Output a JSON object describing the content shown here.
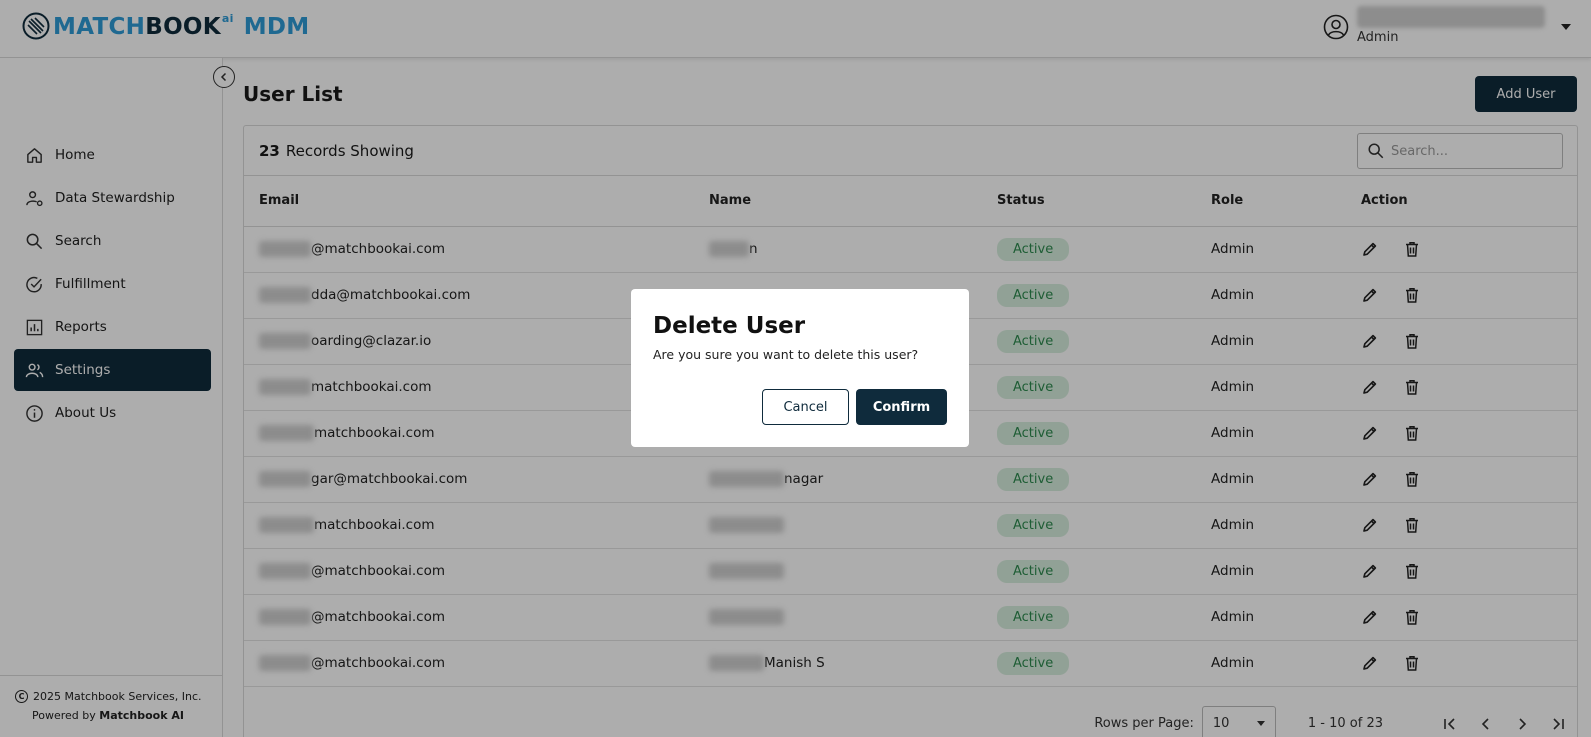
{
  "header": {
    "brand_blue": "MATCH",
    "brand_dark": "BOOK",
    "brand_sup": "ai",
    "brand_mdm": "MDM",
    "user_role": "Admin"
  },
  "sidebar": {
    "items": [
      {
        "label": "Home",
        "icon": "home-icon"
      },
      {
        "label": "Data Stewardship",
        "icon": "user-gear-icon"
      },
      {
        "label": "Search",
        "icon": "search-icon"
      },
      {
        "label": "Fulfillment",
        "icon": "check-circle-icon"
      },
      {
        "label": "Reports",
        "icon": "bar-chart-icon"
      },
      {
        "label": "Settings",
        "icon": "users-icon",
        "active": true
      },
      {
        "label": "About Us",
        "icon": "info-icon"
      }
    ],
    "footer_copyright": "2025 Matchbook Services, Inc.",
    "footer_powered_prefix": "Powered by",
    "footer_powered_brand": "Matchbook AI"
  },
  "main": {
    "title": "User List",
    "add_user_label": "Add User",
    "records_count": "23",
    "records_label": "Records Showing",
    "search_placeholder": "Search...",
    "columns": {
      "email": "Email",
      "name": "Name",
      "status": "Status",
      "role": "Role",
      "action": "Action"
    },
    "rows": [
      {
        "email": "@matchbookai.com",
        "name": "n",
        "status": "Active",
        "role": "Admin"
      },
      {
        "email": "dda@matchbookai.com",
        "name": "",
        "status": "Active",
        "role": "Admin"
      },
      {
        "email": "oarding@clazar.io",
        "name": "",
        "status": "Active",
        "role": "Admin"
      },
      {
        "email": "matchbookai.com",
        "name": "",
        "status": "Active",
        "role": "Admin"
      },
      {
        "email": "matchbookai.com",
        "name": "",
        "status": "Active",
        "role": "Admin"
      },
      {
        "email": "gar@matchbookai.com",
        "name": "nagar",
        "status": "Active",
        "role": "Admin"
      },
      {
        "email": "matchbookai.com",
        "name": "",
        "status": "Active",
        "role": "Admin"
      },
      {
        "email": "@matchbookai.com",
        "name": "",
        "status": "Active",
        "role": "Admin"
      },
      {
        "email": "@matchbookai.com",
        "name": "",
        "status": "Active",
        "role": "Admin"
      },
      {
        "email": "@matchbookai.com",
        "name": "Manish S",
        "status": "Active",
        "role": "Admin"
      }
    ],
    "pager": {
      "rows_label": "Rows per Page:",
      "rows_value": "10",
      "range": "1 - 10 of 23"
    }
  },
  "modal": {
    "title": "Delete User",
    "message": "Are you sure you want to delete this user?",
    "cancel_label": "Cancel",
    "confirm_label": "Confirm"
  },
  "colors": {
    "brand_dark": "#0f2b3c",
    "brand_blue": "#2f9bd6",
    "status_active_bg": "#d6eedd",
    "status_active_text": "#2d8a4e"
  }
}
